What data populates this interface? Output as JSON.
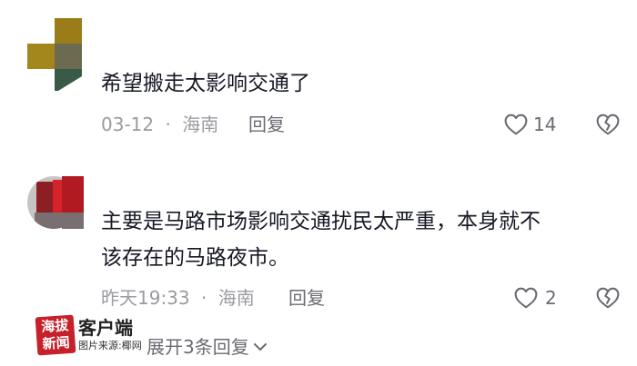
{
  "comments": [
    {
      "text": "希望搬走太影响交通了",
      "date": "03-12",
      "separator": "·",
      "location": "海南",
      "reply_label": "回复",
      "likes": "14",
      "avatar_colors": [
        "#9a7c18",
        "#ffffff",
        "#6d6a52",
        "#3a5a48"
      ]
    },
    {
      "text_line1": "主要是马路市场影响交通扰民太严重，本身就不",
      "text_line2": "该存在的马路夜市。",
      "date": "昨天19:33",
      "separator": "·",
      "location": "海南",
      "reply_label": "回复",
      "likes": "2",
      "avatar_colors": [
        "#c7c5c4",
        "#8c1f24",
        "#d5232b",
        "#7a6f70"
      ]
    }
  ],
  "expand_label": "展开3条回复",
  "icons": {
    "like": "heart-outline-icon",
    "dislike": "broken-heart-icon",
    "expand": "chevron-down-icon"
  },
  "watermark": {
    "badge_chars": [
      "海",
      "拔",
      "新",
      "闻"
    ],
    "title": "客户端",
    "credit": "图片来源:椰网",
    "badge_color": "#c6202a"
  }
}
